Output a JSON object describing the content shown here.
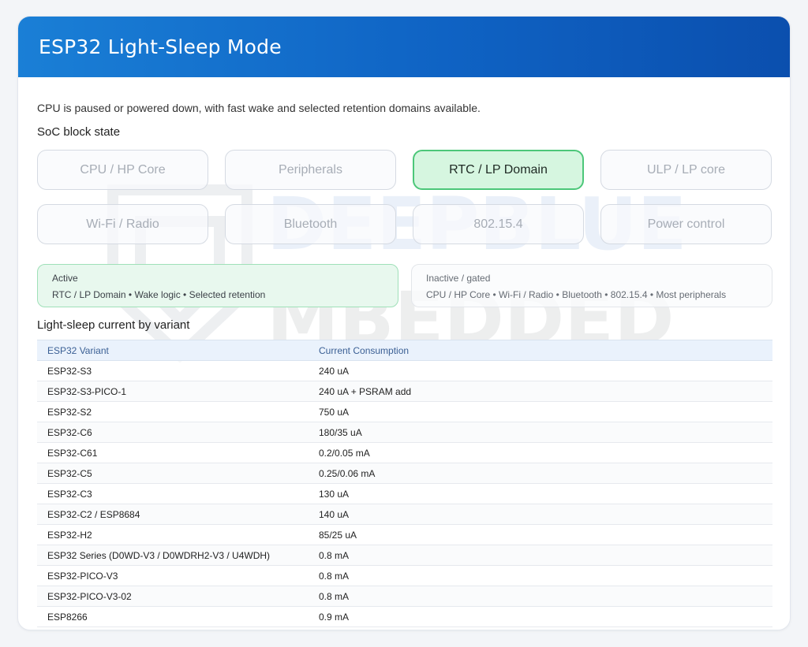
{
  "header": {
    "title": "ESP32 Light-Sleep Mode"
  },
  "description": "CPU is paused or powered down, with fast wake and selected retention domains available.",
  "soc_section": {
    "title": "SoC block state",
    "blocks": [
      {
        "label": "CPU / HP Core",
        "active": false
      },
      {
        "label": "Peripherals",
        "active": false
      },
      {
        "label": "RTC / LP Domain",
        "active": true
      },
      {
        "label": "ULP / LP core",
        "active": false
      },
      {
        "label": "Wi-Fi / Radio",
        "active": false
      },
      {
        "label": "Bluetooth",
        "active": false
      },
      {
        "label": "802.15.4",
        "active": false
      },
      {
        "label": "Power control",
        "active": false
      }
    ]
  },
  "legend": {
    "active": {
      "title": "Active",
      "items": "RTC / LP Domain • Wake logic • Selected retention"
    },
    "inactive": {
      "title": "Inactive / gated",
      "items": "CPU / HP Core • Wi-Fi / Radio • Bluetooth • 802.15.4 • Most peripherals"
    }
  },
  "table": {
    "title": "Light-sleep current by variant",
    "columns": [
      "ESP32 Variant",
      "Current Consumption"
    ],
    "rows": [
      [
        "ESP32-S3",
        "240 uA"
      ],
      [
        "ESP32-S3-PICO-1",
        "240 uA + PSRAM add"
      ],
      [
        "ESP32-S2",
        "750 uA"
      ],
      [
        "ESP32-C6",
        "180/35 uA"
      ],
      [
        "ESP32-C61",
        "0.2/0.05 mA"
      ],
      [
        "ESP32-C5",
        "0.25/0.06 mA"
      ],
      [
        "ESP32-C3",
        "130 uA"
      ],
      [
        "ESP32-C2 / ESP8684",
        "140 uA"
      ],
      [
        "ESP32-H2",
        "85/25 uA"
      ],
      [
        "ESP32 Series (D0WD-V3 / D0WDRH2-V3 / U4WDH)",
        "0.8 mA"
      ],
      [
        "ESP32-PICO-V3",
        "0.8 mA"
      ],
      [
        "ESP32-PICO-V3-02",
        "0.8 mA"
      ],
      [
        "ESP8266",
        "0.9 mA"
      ]
    ]
  },
  "watermark": {
    "line1": "DEEPBLUE",
    "line2": "MBEDDED"
  },
  "colors": {
    "header_start": "#1a7fd6",
    "header_end": "#0b4fae",
    "active_fill": "#d6f6e0",
    "active_border": "#4cc779"
  }
}
